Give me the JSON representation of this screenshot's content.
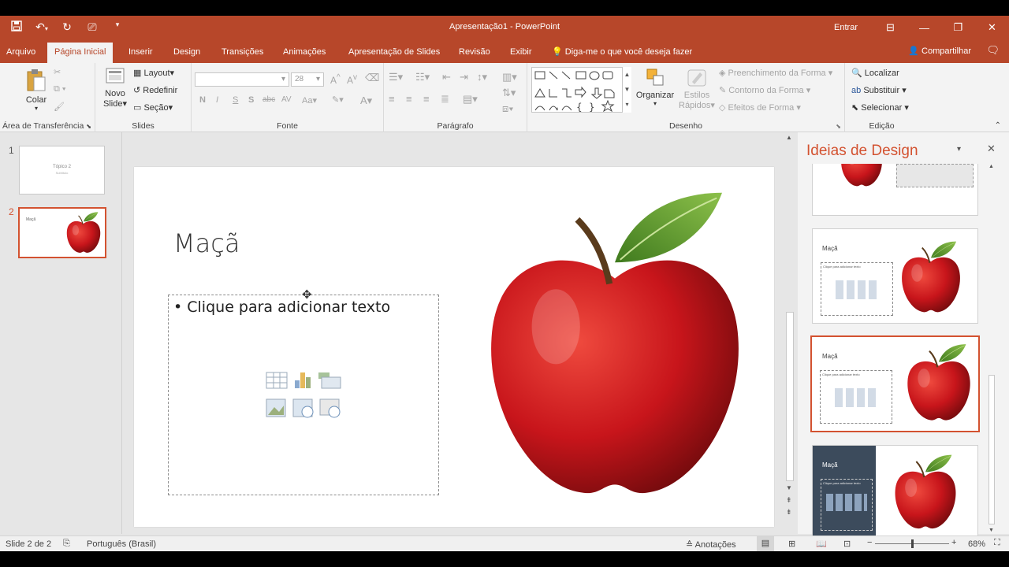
{
  "window": {
    "title": "Apresentação1 - PowerPoint",
    "signin": "Entrar"
  },
  "tabs": [
    {
      "label": "Arquivo"
    },
    {
      "label": "Página Inicial"
    },
    {
      "label": "Inserir"
    },
    {
      "label": "Design"
    },
    {
      "label": "Transições"
    },
    {
      "label": "Animações"
    },
    {
      "label": "Apresentação de Slides"
    },
    {
      "label": "Revisão"
    },
    {
      "label": "Exibir"
    }
  ],
  "tellme": "Diga-me o que você deseja fazer",
  "share": "Compartilhar",
  "ribbon": {
    "clipboard": {
      "paste": "Colar",
      "label": "Área de Transferência"
    },
    "slides": {
      "new_slide_1": "Novo",
      "new_slide_2": "Slide",
      "layout": "Layout",
      "reset": "Redefinir",
      "section": "Seção",
      "label": "Slides"
    },
    "font": {
      "size": "28",
      "label": "Fonte",
      "bold": "N",
      "italic": "I",
      "underline": "S",
      "shadow": "S",
      "strike": "abc",
      "spacing": "AV",
      "case": "Aa"
    },
    "paragraph": {
      "label": "Parágrafo"
    },
    "drawing": {
      "arrange": "Organizar",
      "quick_styles_1": "Estilos",
      "quick_styles_2": "Rápidos",
      "fill": "Preenchimento da Forma",
      "outline": "Contorno da Forma",
      "effects": "Efeitos de Forma",
      "label": "Desenho"
    },
    "editing": {
      "find": "Localizar",
      "replace": "Substituir",
      "select": "Selecionar",
      "label": "Edição"
    }
  },
  "slides_panel": {
    "items": [
      {
        "number": "1",
        "title": "Tópico 2",
        "subtitle": "Subtítulo"
      },
      {
        "number": "2",
        "title": "Maçã"
      }
    ]
  },
  "slide": {
    "title": "Maçã",
    "placeholder": "Clique para adicionar texto",
    "bullet": "•"
  },
  "design_pane": {
    "title": "Ideias de Design",
    "cards": [
      {
        "title": "Maçã",
        "placeholder": "Clique para adicionar texto"
      },
      {
        "title": "Maçã",
        "placeholder": "Clique para adicionar texto"
      },
      {
        "title": "Maçã",
        "placeholder": "Clique para adicionar texto"
      }
    ]
  },
  "status": {
    "slide_info": "Slide 2 de 2",
    "language": "Português (Brasil)",
    "notes": "Anotações",
    "zoom": "68%",
    "zoom_level_fraction": 0.5
  },
  "colors": {
    "accent": "#b7472a",
    "selection": "#d35230",
    "apple_red": "#c8151b",
    "leaf_green": "#5a9a2b"
  }
}
